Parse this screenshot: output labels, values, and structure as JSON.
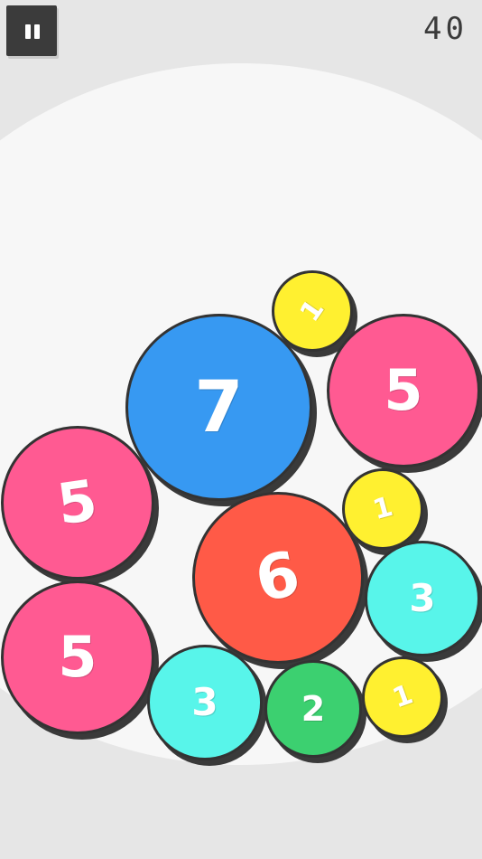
{
  "hud": {
    "pause_icon": "pause-icon",
    "score": "40"
  },
  "colors": {
    "one": "#fff030",
    "two": "#3cd070",
    "three": "#58f5ea",
    "five": "#ff5a92",
    "six": "#ff5a47",
    "seven": "#3799f2",
    "outline": "#333333",
    "background": "#e6e6e6",
    "bowl": "#f7f7f7"
  },
  "balls": [
    {
      "value": "1",
      "color": "#fff030"
    },
    {
      "value": "7",
      "color": "#3799f2"
    },
    {
      "value": "5",
      "color": "#ff5a92"
    },
    {
      "value": "5",
      "color": "#ff5a92"
    },
    {
      "value": "1",
      "color": "#fff030"
    },
    {
      "value": "6",
      "color": "#ff5a47"
    },
    {
      "value": "3",
      "color": "#58f5ea"
    },
    {
      "value": "5",
      "color": "#ff5a92"
    },
    {
      "value": "3",
      "color": "#58f5ea"
    },
    {
      "value": "2",
      "color": "#3cd070"
    },
    {
      "value": "1",
      "color": "#fff030"
    }
  ]
}
